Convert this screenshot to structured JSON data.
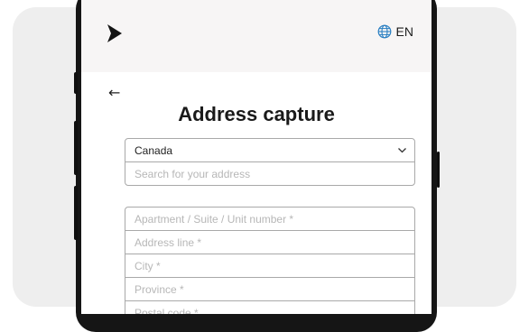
{
  "header": {
    "lang_label": "EN"
  },
  "page": {
    "title": "Address capture"
  },
  "country": {
    "selected": "Canada"
  },
  "search": {
    "placeholder": "Search for your address"
  },
  "address_fields": [
    "Apartment / Suite / Unit number *",
    "Address line *",
    "City *",
    "Province *",
    "Postal code *"
  ],
  "icons": {
    "logo": "chevron-right-logo-icon",
    "language": "globe-icon",
    "back": "arrow-left-icon",
    "dropdown": "chevron-down-icon"
  },
  "colors": {
    "accent": "#2a7fc2",
    "header_bg": "#f7f5f5"
  }
}
